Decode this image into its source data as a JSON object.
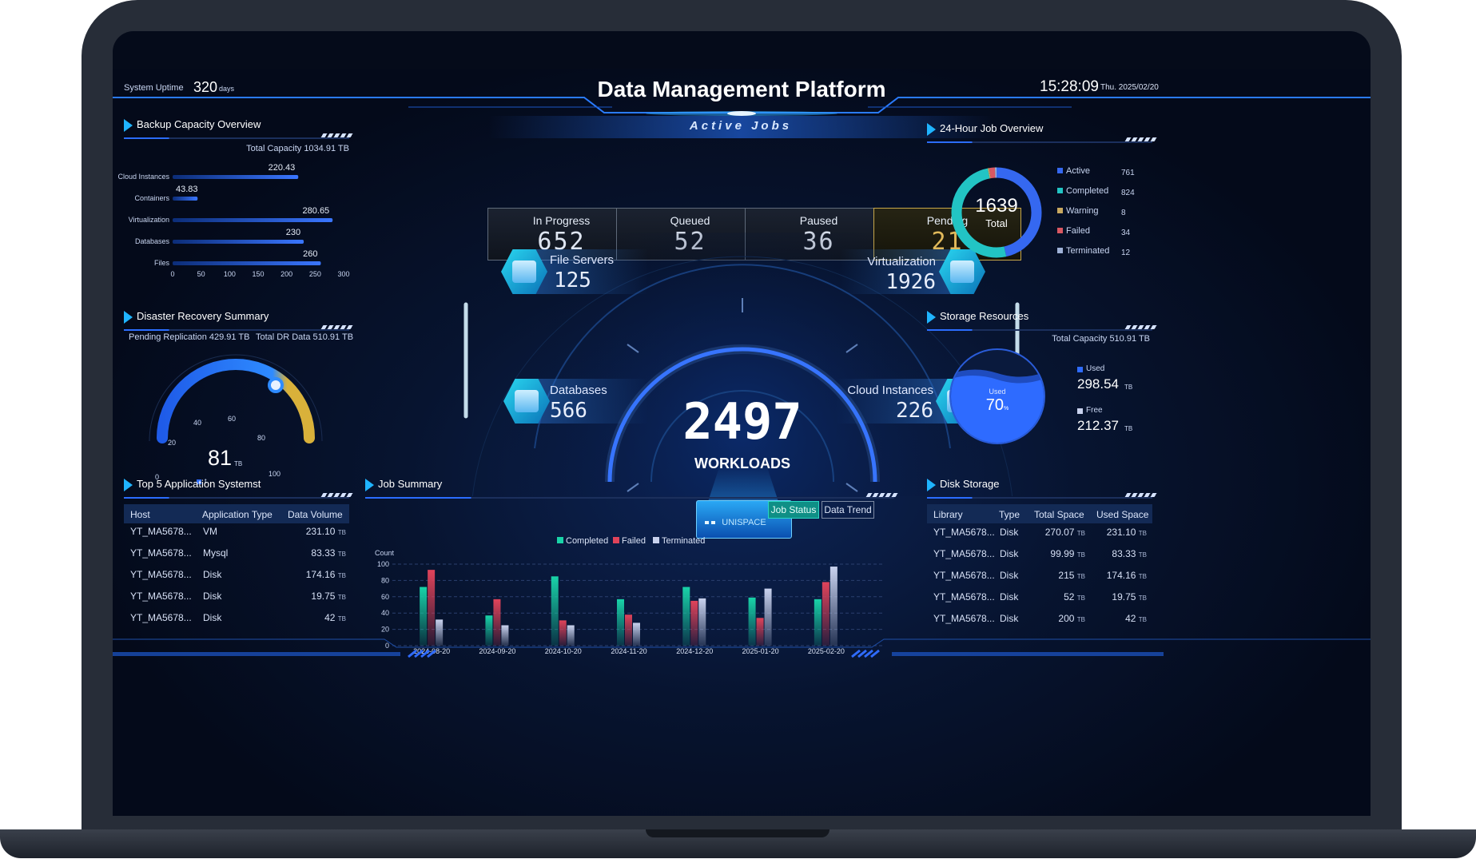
{
  "header": {
    "title": "Data Management Platform",
    "uptime_label": "System Uptime",
    "uptime_value": "320",
    "uptime_unit": "days",
    "time": "15:28:09",
    "date": "Thu. 2025/02/20"
  },
  "active_jobs": {
    "title": "Active Jobs",
    "items": [
      {
        "label": "In Progress",
        "value": "652"
      },
      {
        "label": "Queued",
        "value": "52"
      },
      {
        "label": "Paused",
        "value": "36"
      },
      {
        "label": "Pending",
        "value": "21"
      }
    ]
  },
  "center": {
    "total": "2497",
    "label": "WORKLOADS",
    "base_label": "UNISPACE",
    "services": [
      {
        "label": "File Servers",
        "value": "125",
        "icon": "folder-icon"
      },
      {
        "label": "Virtualization",
        "value": "1926",
        "icon": "monitor-icon"
      },
      {
        "label": "Databases",
        "value": "566",
        "icon": "sql-database-icon"
      },
      {
        "label": "Cloud Instances",
        "value": "226",
        "icon": "cloud-server-icon"
      }
    ]
  },
  "backup_capacity": {
    "title": "Backup Capacity Overview",
    "total_label": "Total Capacity 1034.91 TB",
    "categories": [
      "Cloud Instances",
      "Containers",
      "Virtualization",
      "Databases",
      "Files"
    ],
    "values": [
      220.43,
      43.83,
      280.65,
      230,
      260
    ],
    "value_labels": [
      "220.43",
      "43.83",
      "280.65",
      "230",
      "260"
    ],
    "xticks": [
      "0",
      "50",
      "100",
      "150",
      "200",
      "250",
      "300"
    ]
  },
  "disaster_recovery": {
    "title": "Disaster Recovery Summary",
    "pending_label": "Pending Replication 429.91 TB",
    "total_label": "Total DR Data 510.91 TB",
    "gauge_value": "81",
    "gauge_unit": "TB",
    "ticks": [
      "0",
      "20",
      "40",
      "60",
      "80",
      "100"
    ],
    "legend": "t"
  },
  "top_apps": {
    "title": "Top 5 Application Systemst",
    "columns": [
      "Host",
      "Application Type",
      "Data Volume"
    ],
    "rows": [
      {
        "host": "YT_MA5678...",
        "type": "VM",
        "volume": "231.10",
        "unit": "TB"
      },
      {
        "host": "YT_MA5678...",
        "type": "Mysql",
        "volume": "83.33",
        "unit": "TB"
      },
      {
        "host": "YT_MA5678...",
        "type": "Disk",
        "volume": "174.16",
        "unit": "TB"
      },
      {
        "host": "YT_MA5678...",
        "type": "Disk",
        "volume": "19.75",
        "unit": "TB"
      },
      {
        "host": "YT_MA5678...",
        "type": "Disk",
        "volume": "42",
        "unit": "TB"
      }
    ]
  },
  "job_overview": {
    "title": "24-Hour Job Overview",
    "total": "1639",
    "total_label": "Total",
    "items": [
      {
        "label": "Active",
        "value": "761",
        "color": "#3568f0"
      },
      {
        "label": "Completed",
        "value": "824",
        "color": "#22c4c4"
      },
      {
        "label": "Warning",
        "value": "8",
        "color": "#c8a860"
      },
      {
        "label": "Failed",
        "value": "34",
        "color": "#d95862"
      },
      {
        "label": "Terminated",
        "value": "12",
        "color": "#9fb2d8"
      }
    ]
  },
  "storage": {
    "title": "Storage Resources",
    "total_label": "Total Capacity 510.91 TB",
    "used_label": "Used",
    "used_percent": "70",
    "percent_sign": "%",
    "legend_used": "Used",
    "used_value": "298.54",
    "legend_free": "Free",
    "free_value": "212.37",
    "unit": "TB"
  },
  "disk_storage": {
    "title": "Disk Storage",
    "columns": [
      "Library",
      "Type",
      "Total Space",
      "Used Space"
    ],
    "rows": [
      {
        "library": "YT_MA5678...",
        "type": "Disk",
        "total": "270.07",
        "used": "231.10",
        "unit": "TB"
      },
      {
        "library": "YT_MA5678...",
        "type": "Disk",
        "total": "99.99",
        "used": "83.33",
        "unit": "TB"
      },
      {
        "library": "YT_MA5678...",
        "type": "Disk",
        "total": "215",
        "used": "174.16",
        "unit": "TB"
      },
      {
        "library": "YT_MA5678...",
        "type": "Disk",
        "total": "52",
        "used": "19.75",
        "unit": "TB"
      },
      {
        "library": "YT_MA5678...",
        "type": "Disk",
        "total": "200",
        "used": "42",
        "unit": "TB"
      }
    ]
  },
  "job_summary": {
    "title": "Job Summary",
    "tabs": [
      "Job Status",
      "Data Trend"
    ],
    "active_tab": "Job Status"
  },
  "chart_data": {
    "type": "bar",
    "ylabel": "Count",
    "ylim": [
      0,
      100
    ],
    "yticks": [
      "0",
      "20",
      "40",
      "60",
      "80",
      "100"
    ],
    "categories": [
      "2024-08-20",
      "2024-09-20",
      "2024-10-20",
      "2024-11-20",
      "2024-12-20",
      "2025-01-20",
      "2025-02-20"
    ],
    "series": [
      {
        "name": "Completed",
        "color": "#19d3a8",
        "values": [
          72,
          37,
          85,
          57,
          72,
          59,
          57
        ]
      },
      {
        "name": "Failed",
        "color": "#e0435a",
        "values": [
          93,
          57,
          31,
          38,
          55,
          34,
          78
        ]
      },
      {
        "name": "Terminated",
        "color": "#c9d2ee",
        "values": [
          32,
          25,
          25,
          28,
          58,
          70,
          97
        ]
      }
    ],
    "grid": true,
    "legend_position": "top"
  }
}
